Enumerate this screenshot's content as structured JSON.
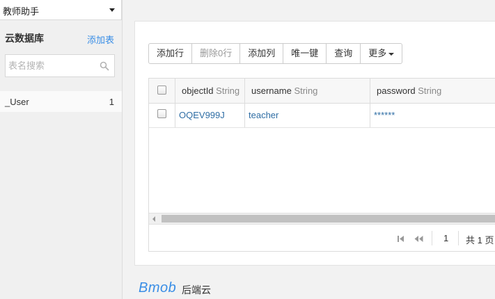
{
  "app_selector": {
    "value": "教师助手"
  },
  "sidebar": {
    "title": "云数据库",
    "add_table": "添加表",
    "search_placeholder": "表名搜索",
    "tables": [
      {
        "name": "_User",
        "count": "1"
      }
    ]
  },
  "toolbar": {
    "add_row": "添加行",
    "delete_rows": "删除0行",
    "add_column": "添加列",
    "unique_key": "唯一键",
    "query": "查询",
    "more": "更多"
  },
  "grid": {
    "columns": [
      {
        "name": "objectId",
        "type": "String"
      },
      {
        "name": "username",
        "type": "String"
      },
      {
        "name": "password",
        "type": "String"
      }
    ],
    "rows": [
      {
        "objectId": "OQEV999J",
        "username": "teacher",
        "password": "******"
      }
    ]
  },
  "pagination": {
    "current_page": "1",
    "total_label": "共 1 页"
  },
  "footer": {
    "logo": "Bmob",
    "text": "后端云"
  },
  "colors": {
    "accent": "#3a8ee6",
    "link": "#2e6da4"
  }
}
